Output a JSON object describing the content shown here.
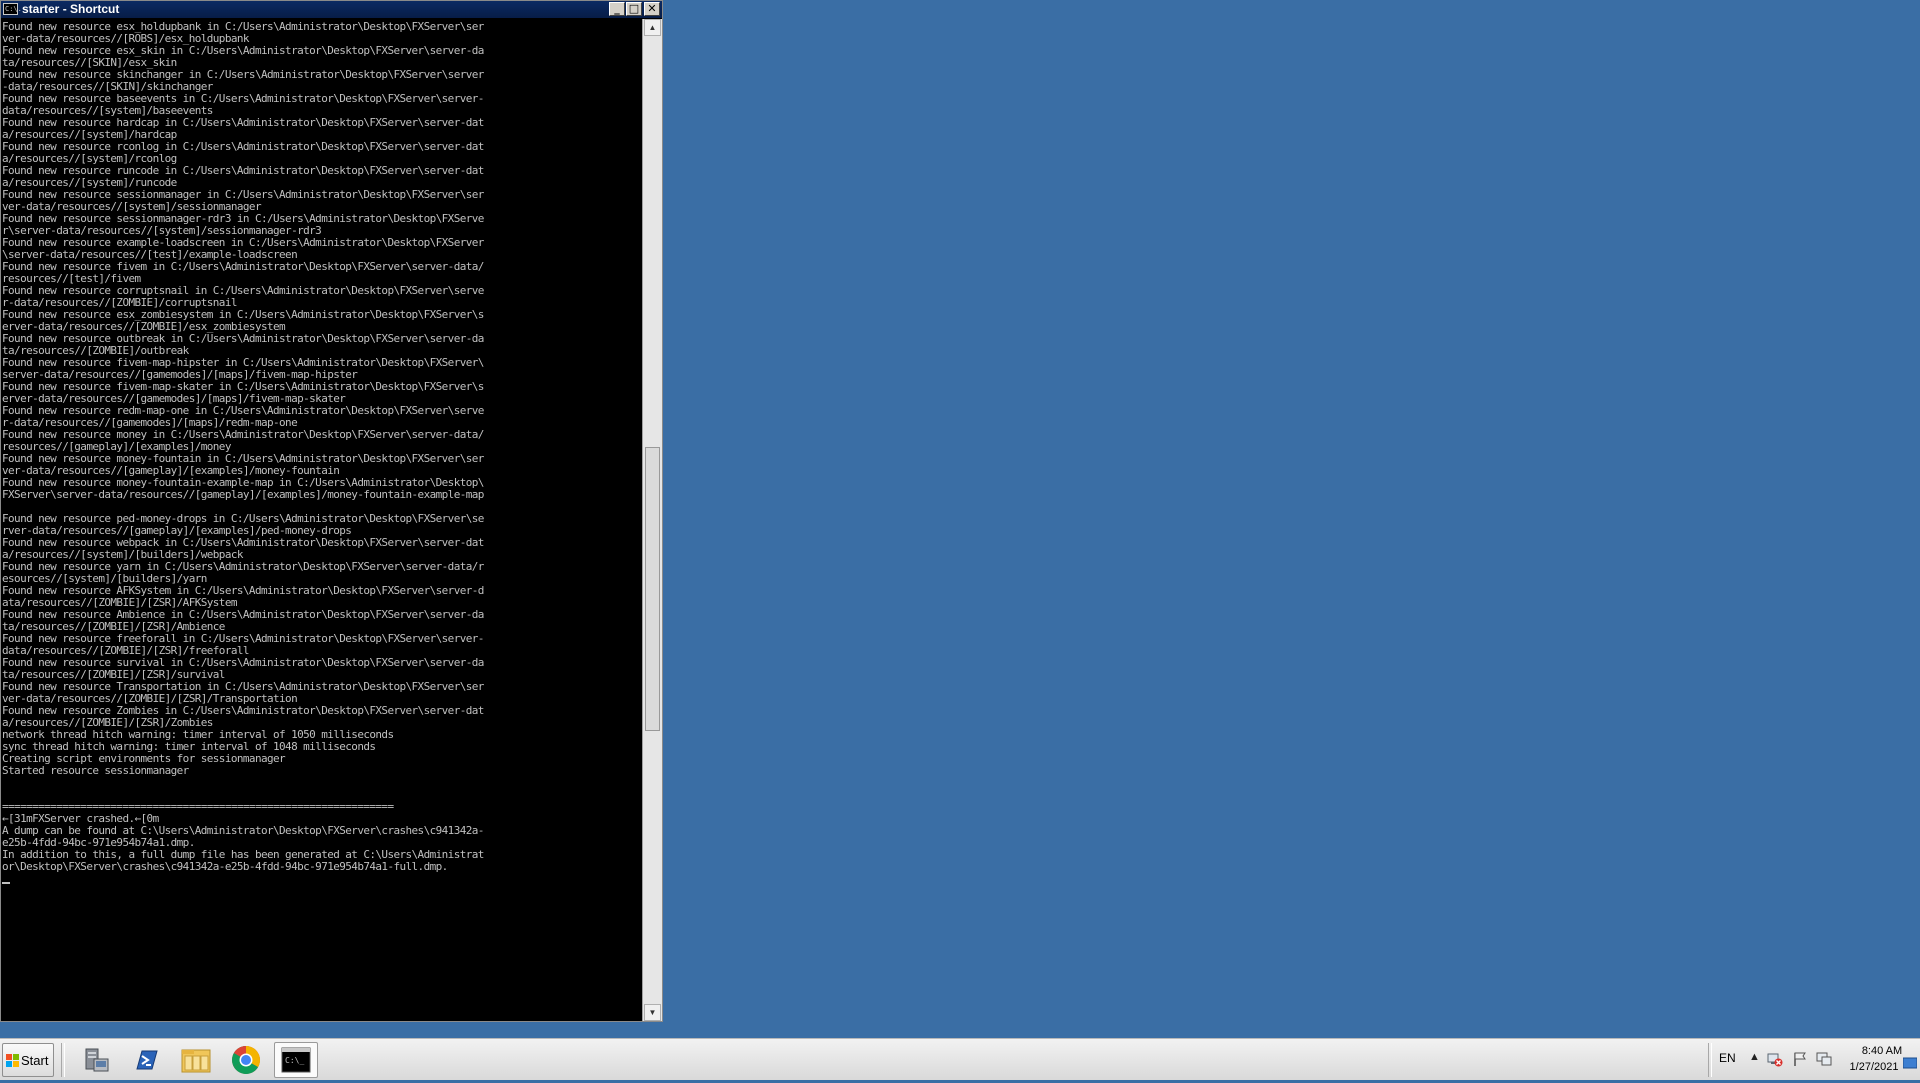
{
  "window": {
    "title": "starter - Shortcut",
    "icon_text": "C:\\.",
    "minimize_label": "_",
    "maximize_label": "□",
    "close_label": "✕"
  },
  "console": {
    "lines": [
      "Found new resource esx_holdupbank in C:/Users\\Administrator\\Desktop\\FXServer\\ser",
      "ver-data/resources//[ROBS]/esx_holdupbank",
      "Found new resource esx_skin in C:/Users\\Administrator\\Desktop\\FXServer\\server-da",
      "ta/resources//[SKIN]/esx_skin",
      "Found new resource skinchanger in C:/Users\\Administrator\\Desktop\\FXServer\\server",
      "-data/resources//[SKIN]/skinchanger",
      "Found new resource baseevents in C:/Users\\Administrator\\Desktop\\FXServer\\server-",
      "data/resources//[system]/baseevents",
      "Found new resource hardcap in C:/Users\\Administrator\\Desktop\\FXServer\\server-dat",
      "a/resources//[system]/hardcap",
      "Found new resource rconlog in C:/Users\\Administrator\\Desktop\\FXServer\\server-dat",
      "a/resources//[system]/rconlog",
      "Found new resource runcode in C:/Users\\Administrator\\Desktop\\FXServer\\server-dat",
      "a/resources//[system]/runcode",
      "Found new resource sessionmanager in C:/Users\\Administrator\\Desktop\\FXServer\\ser",
      "ver-data/resources//[system]/sessionmanager",
      "Found new resource sessionmanager-rdr3 in C:/Users\\Administrator\\Desktop\\FXServe",
      "r\\server-data/resources//[system]/sessionmanager-rdr3",
      "Found new resource example-loadscreen in C:/Users\\Administrator\\Desktop\\FXServer",
      "\\server-data/resources//[test]/example-loadscreen",
      "Found new resource fivem in C:/Users\\Administrator\\Desktop\\FXServer\\server-data/",
      "resources//[test]/fivem",
      "Found new resource corruptsnail in C:/Users\\Administrator\\Desktop\\FXServer\\serve",
      "r-data/resources//[ZOMBIE]/corruptsnail",
      "Found new resource esx_zombiesystem in C:/Users\\Administrator\\Desktop\\FXServer\\s",
      "erver-data/resources//[ZOMBIE]/esx_zombiesystem",
      "Found new resource outbreak in C:/Users\\Administrator\\Desktop\\FXServer\\server-da",
      "ta/resources//[ZOMBIE]/outbreak",
      "Found new resource fivem-map-hipster in C:/Users\\Administrator\\Desktop\\FXServer\\",
      "server-data/resources//[gamemodes]/[maps]/fivem-map-hipster",
      "Found new resource fivem-map-skater in C:/Users\\Administrator\\Desktop\\FXServer\\s",
      "erver-data/resources//[gamemodes]/[maps]/fivem-map-skater",
      "Found new resource redm-map-one in C:/Users\\Administrator\\Desktop\\FXServer\\serve",
      "r-data/resources//[gamemodes]/[maps]/redm-map-one",
      "Found new resource money in C:/Users\\Administrator\\Desktop\\FXServer\\server-data/",
      "resources//[gameplay]/[examples]/money",
      "Found new resource money-fountain in C:/Users\\Administrator\\Desktop\\FXServer\\ser",
      "ver-data/resources//[gameplay]/[examples]/money-fountain",
      "Found new resource money-fountain-example-map in C:/Users\\Administrator\\Desktop\\",
      "FXServer\\server-data/resources//[gameplay]/[examples]/money-fountain-example-map",
      "",
      "Found new resource ped-money-drops in C:/Users\\Administrator\\Desktop\\FXServer\\se",
      "rver-data/resources//[gameplay]/[examples]/ped-money-drops",
      "Found new resource webpack in C:/Users\\Administrator\\Desktop\\FXServer\\server-dat",
      "a/resources//[system]/[builders]/webpack",
      "Found new resource yarn in C:/Users\\Administrator\\Desktop\\FXServer\\server-data/r",
      "esources//[system]/[builders]/yarn",
      "Found new resource AFKSystem in C:/Users\\Administrator\\Desktop\\FXServer\\server-d",
      "ata/resources//[ZOMBIE]/[ZSR]/AFKSystem",
      "Found new resource Ambience in C:/Users\\Administrator\\Desktop\\FXServer\\server-da",
      "ta/resources//[ZOMBIE]/[ZSR]/Ambience",
      "Found new resource freeforall in C:/Users\\Administrator\\Desktop\\FXServer\\server-",
      "data/resources//[ZOMBIE]/[ZSR]/freeforall",
      "Found new resource survival in C:/Users\\Administrator\\Desktop\\FXServer\\server-da",
      "ta/resources//[ZOMBIE]/[ZSR]/survival",
      "Found new resource Transportation in C:/Users\\Administrator\\Desktop\\FXServer\\ser",
      "ver-data/resources//[ZOMBIE]/[ZSR]/Transportation",
      "Found new resource Zombies in C:/Users\\Administrator\\Desktop\\FXServer\\server-dat",
      "a/resources//[ZOMBIE]/[ZSR]/Zombies",
      "network thread hitch warning: timer interval of 1050 milliseconds",
      "sync thread hitch warning: timer interval of 1048 milliseconds",
      "Creating script environments for sessionmanager",
      "Started resource sessionmanager",
      "",
      "",
      "=================================================================",
      "←[31mFXServer crashed.←[0m",
      "A dump can be found at C:\\Users\\Administrator\\Desktop\\FXServer\\crashes\\c941342a-",
      "e25b-4fdd-94bc-971e954b74a1.dmp.",
      "In addition to this, a full dump file has been generated at C:\\Users\\Administrat",
      "or\\Desktop\\FXServer\\crashes\\c941342a-e25b-4fdd-94bc-971e954b74a1-full.dmp."
    ]
  },
  "taskbar": {
    "start_label": "Start",
    "apps": [
      {
        "name": "server-manager",
        "icon": "server-manager-icon"
      },
      {
        "name": "powershell",
        "icon": "powershell-icon"
      },
      {
        "name": "file-explorer",
        "icon": "folder-icon"
      },
      {
        "name": "chrome",
        "icon": "chrome-icon"
      },
      {
        "name": "cmd",
        "icon": "console-icon",
        "active": true,
        "icon_text": "C:\\_"
      }
    ],
    "language": "EN",
    "tray_chevron": "▲",
    "time": "8:40 AM",
    "date": "1/27/2021"
  },
  "colors": {
    "desktop": "#3a6ea5",
    "console_bg": "#000000",
    "console_text": "#c0c0c0",
    "title_bar": "#0b2a63"
  }
}
